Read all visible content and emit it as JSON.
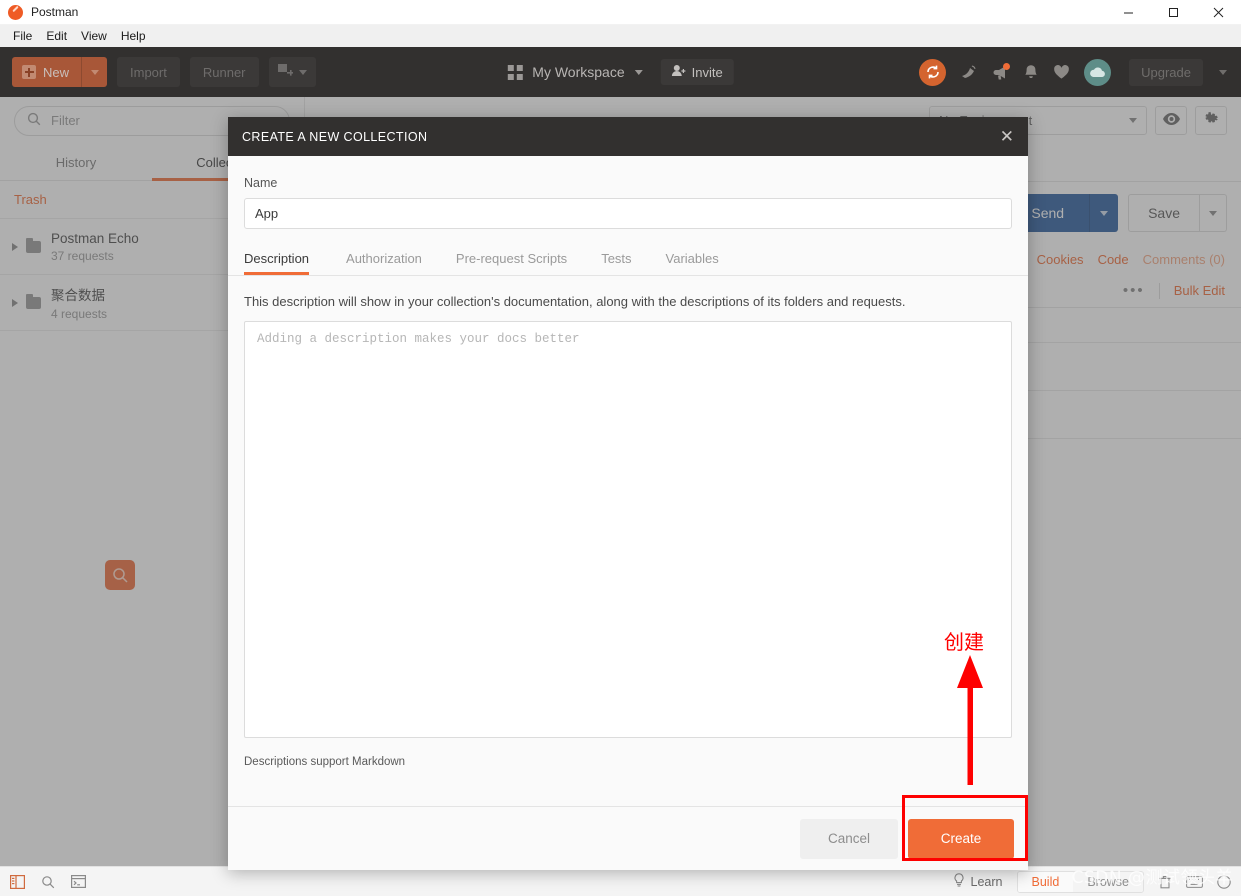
{
  "window": {
    "app_title": "Postman",
    "controls": {
      "minimize": "minimize-icon",
      "maximize": "maximize-icon",
      "close": "close-icon"
    }
  },
  "menubar": {
    "items": [
      "File",
      "Edit",
      "View",
      "Help"
    ]
  },
  "toolbar": {
    "new_label": "New",
    "import_label": "Import",
    "runner_label": "Runner",
    "new_window_icon": "new-window-icon",
    "workspace_label": "My Workspace",
    "invite_label": "Invite",
    "upgrade_label": "Upgrade",
    "icons": [
      "sync-icon",
      "satellite-icon",
      "megaphone-icon",
      "bell-icon",
      "heart-icon",
      "cloud-icon"
    ],
    "accent": "#f06c37"
  },
  "sidebar": {
    "filter_placeholder": "Filter",
    "tabs": [
      {
        "label": "History",
        "active": false
      },
      {
        "label": "Collections",
        "active": true
      }
    ],
    "trash_label": "Trash",
    "collections": [
      {
        "name": "Postman Echo",
        "requests": "37 requests"
      },
      {
        "name": "聚合数据",
        "requests": "4 requests"
      }
    ],
    "search_icon": "search-icon"
  },
  "right_pane": {
    "environment_label": "No Environment",
    "eye_icon": "eye-icon",
    "settings_icon": "gear-icon",
    "send_label": "Send",
    "save_label": "Save",
    "links": [
      "Cookies",
      "Code",
      "Comments (0)"
    ],
    "bulk_edit_label": "Bulk Edit",
    "more_icon": "ellipsis-icon"
  },
  "modal": {
    "title": "CREATE A NEW COLLECTION",
    "close_icon": "close-icon",
    "name_label": "Name",
    "name_value": "App",
    "name_placeholder": "Name",
    "tabs": [
      {
        "label": "Description",
        "active": true
      },
      {
        "label": "Authorization",
        "active": false
      },
      {
        "label": "Pre-request Scripts",
        "active": false
      },
      {
        "label": "Tests",
        "active": false
      },
      {
        "label": "Variables",
        "active": false
      }
    ],
    "description_help": "This description will show in your collection's documentation, along with the descriptions of its folders and requests.",
    "description_value": "",
    "description_placeholder": "Adding a description makes your docs better",
    "markdown_note": "Descriptions support Markdown",
    "cancel_label": "Cancel",
    "create_label": "Create",
    "create_color": "#f06c37"
  },
  "annotation": {
    "text": "创建",
    "color": "#fe0000",
    "arrow_icon": "up-arrow-icon",
    "highlight_target": "create-button"
  },
  "statusbar": {
    "left_icons": [
      "sidebar-toggle-icon",
      "find-icon",
      "console-icon"
    ],
    "learn_label": "Learn",
    "build_label": "Build",
    "browse_label": "Browse",
    "bulb_icon": "bulb-icon",
    "trash_icon": "trash-icon",
    "keyboard_icon": "keyboard-icon",
    "help_icon": "help-icon"
  },
  "watermark": {
    "text": "CSDN @测试领头羊"
  }
}
